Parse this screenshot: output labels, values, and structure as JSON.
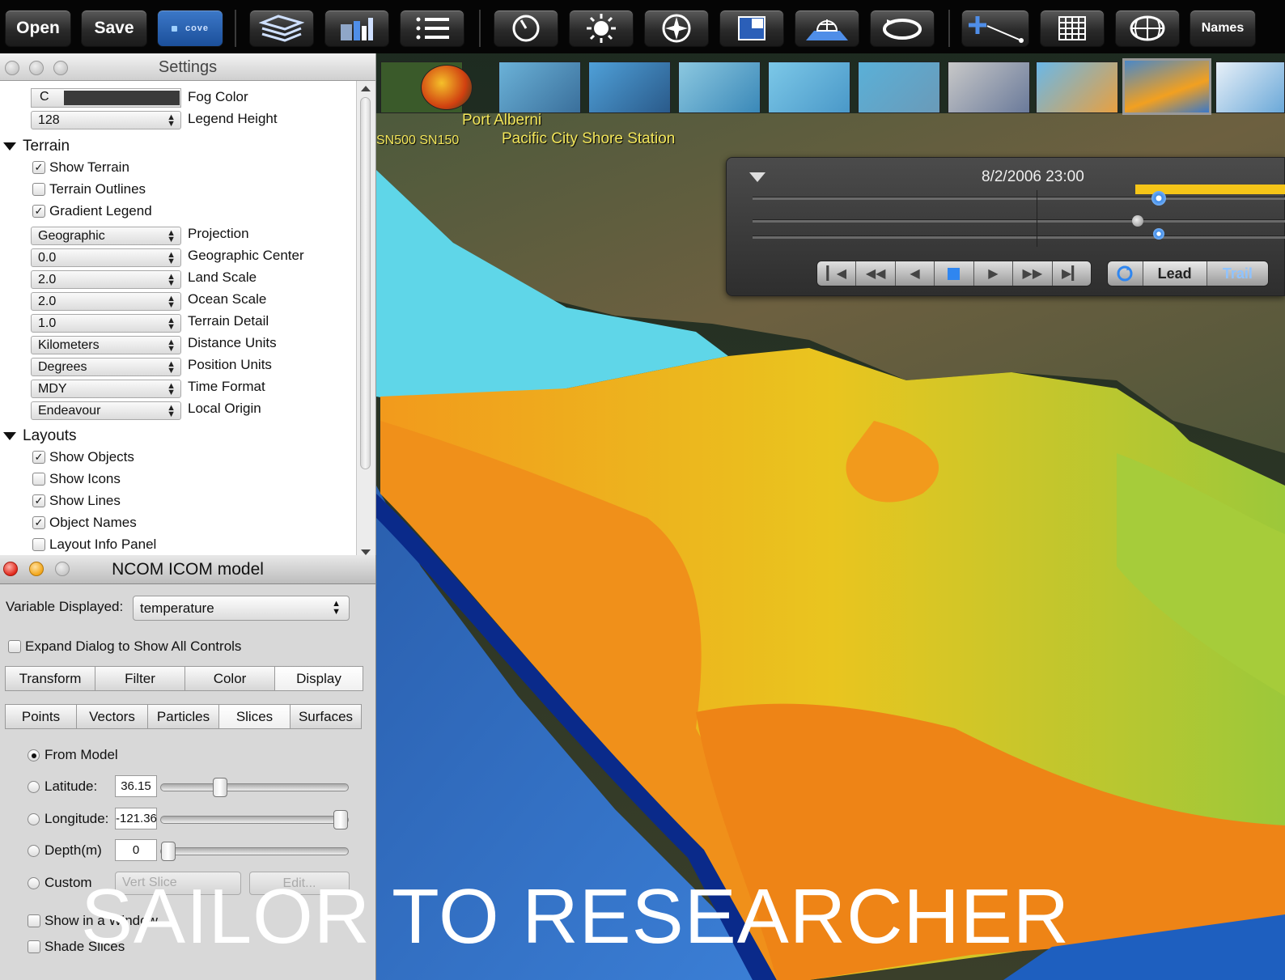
{
  "toolbar": {
    "open_label": "Open",
    "save_label": "Save",
    "cove_label": "cove",
    "names_label": "Names",
    "icons": [
      "layers-icon",
      "bar-chart-icon",
      "list-icon",
      "clock-icon",
      "sun-icon",
      "compass-icon",
      "window-icon",
      "grid-plane-icon",
      "rotate-icon",
      "add-line-icon",
      "table-icon",
      "globe-icon"
    ]
  },
  "map": {
    "label_port_alberni": "Port Alberni",
    "label_sn": "SN500 SN150",
    "label_pacific_city": "Pacific City Shore Station"
  },
  "timeline": {
    "date": "8/2/2006 23:00",
    "lead_label": "Lead",
    "trail_label": "Trail"
  },
  "settings": {
    "title": "Settings",
    "fog_color_swatch": "C",
    "fog_color_label": "Fog Color",
    "legend_height_value": "128",
    "legend_height_label": "Legend Height",
    "terrain_header": "Terrain",
    "terrain_checks": [
      {
        "label": "Show Terrain",
        "checked": true
      },
      {
        "label": "Terrain Outlines",
        "checked": false
      },
      {
        "label": "Gradient Legend",
        "checked": true
      }
    ],
    "terrain_fields": [
      {
        "value": "Geographic",
        "label": "Projection"
      },
      {
        "value": "0.0",
        "label": "Geographic Center"
      },
      {
        "value": "2.0",
        "label": "Land Scale"
      },
      {
        "value": "2.0",
        "label": "Ocean Scale"
      },
      {
        "value": "1.0",
        "label": "Terrain Detail"
      },
      {
        "value": "Kilometers",
        "label": "Distance Units"
      },
      {
        "value": "Degrees",
        "label": "Position Units"
      },
      {
        "value": "MDY",
        "label": "Time Format"
      },
      {
        "value": "Endeavour",
        "label": "Local Origin"
      }
    ],
    "layouts_header": "Layouts",
    "layout_checks": [
      {
        "label": "Show Objects",
        "checked": true
      },
      {
        "label": "Show Icons",
        "checked": false
      },
      {
        "label": "Show Lines",
        "checked": true
      },
      {
        "label": "Object Names",
        "checked": true
      },
      {
        "label": "Layout Info Panel",
        "checked": false
      }
    ]
  },
  "ncom": {
    "title": "NCOM ICOM model",
    "variable_label": "Variable Displayed:",
    "variable_value": "temperature",
    "expand_label": "Expand Dialog to Show All Controls",
    "tabs_row1": [
      "Transform",
      "Filter",
      "Color",
      "Display"
    ],
    "tabs_row2": [
      "Points",
      "Vectors",
      "Particles",
      "Slices",
      "Surfaces"
    ],
    "from_model_label": "From Model",
    "latitude_label": "Latitude:",
    "latitude_value": "36.15",
    "latitude_slider": 0.3,
    "longitude_label": "Longitude:",
    "longitude_value": "-121.36",
    "longitude_slider": 1.0,
    "depth_label": "Depth(m)",
    "depth_value": "0",
    "depth_slider": 0.0,
    "custom_label": "Custom",
    "vert_slice_value": "Vert Slice",
    "edit_label": "Edit...",
    "show_in_window_label": "Show in a Window",
    "shade_slices_label": "Shade Slices"
  },
  "overlay_title": "SAILOR TO RESEARCHER",
  "colors": {
    "ocean_deep": "#2f6fc7",
    "model_orange": "#f08a1a",
    "model_yellow": "#e8c820",
    "shallow": "#5fd6e8",
    "timeline_accent": "#f5c518"
  }
}
